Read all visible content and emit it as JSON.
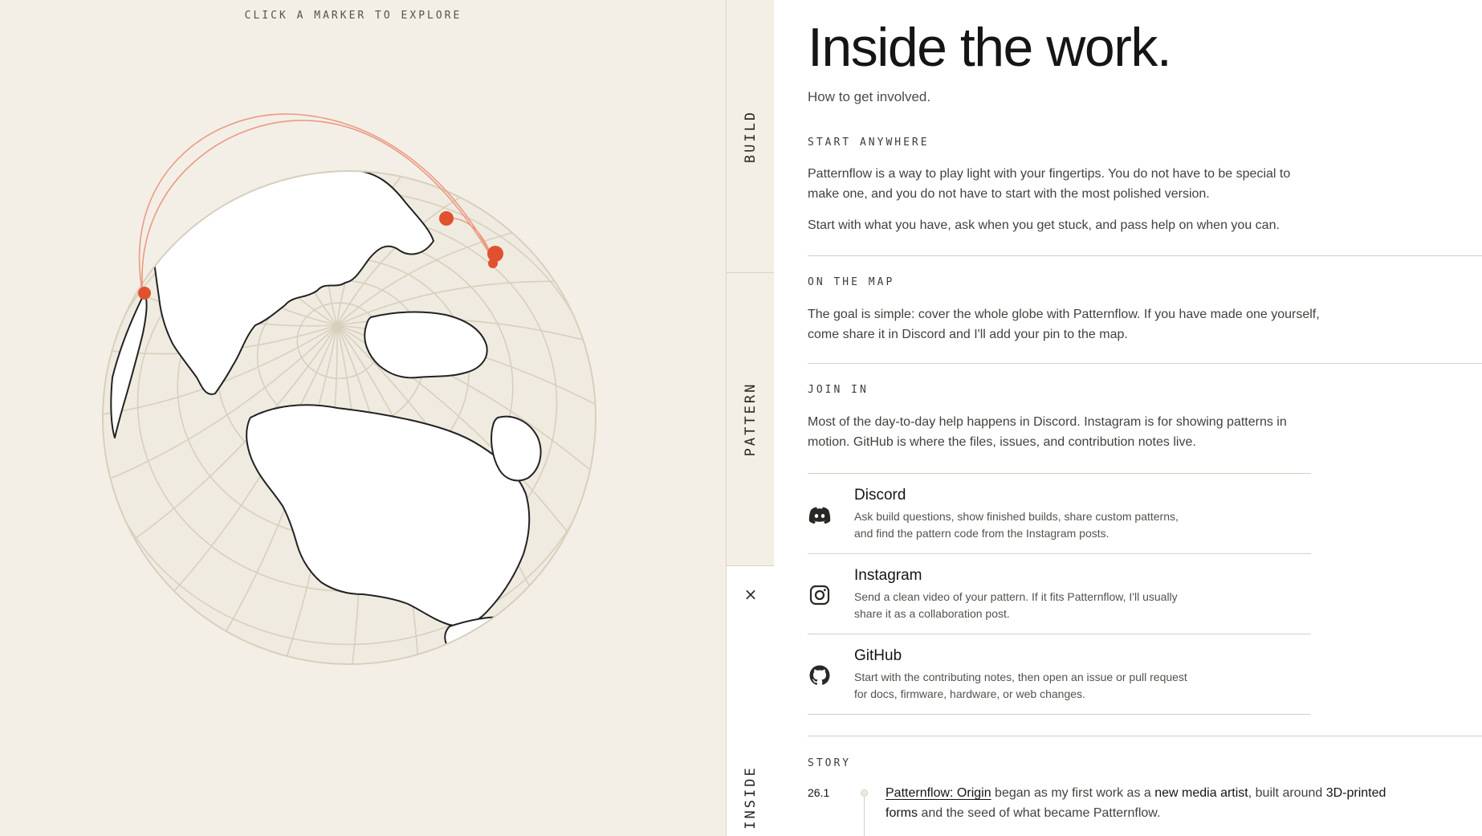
{
  "globe": {
    "hint": "CLICK A MARKER TO EXPLORE",
    "marker_color": "#e0522f",
    "arc_color": "#eb9a82"
  },
  "tabs": [
    {
      "label": "BUILD"
    },
    {
      "label": "PATTERN"
    },
    {
      "label": "INSIDE"
    }
  ],
  "close_symbol": "×",
  "content": {
    "title": "Inside the work.",
    "subtitle": "How to get involved.",
    "sections": [
      {
        "label": "START ANYWHERE",
        "paragraphs": [
          "Patternflow is a way to play light with your fingertips. You do not have to be special to make one, and you do not have to start with the most polished version.",
          "Start with what you have, ask when you get stuck, and pass help on when you can."
        ]
      },
      {
        "label": "ON THE MAP",
        "paragraphs": [
          "The goal is simple: cover the whole globe with Patternflow. If you have made one yourself, come share it in Discord and I'll add your pin to the map."
        ]
      },
      {
        "label": "JOIN IN",
        "paragraphs": [
          "Most of the day-to-day help happens in Discord. Instagram is for showing patterns in motion. GitHub is where the files, issues, and contribution notes live."
        ]
      }
    ],
    "socials": [
      {
        "name": "Discord",
        "icon": "discord-icon",
        "desc": "Ask build questions, show finished builds, share custom patterns, and find the pattern code from the Instagram posts."
      },
      {
        "name": "Instagram",
        "icon": "instagram-icon",
        "desc": "Send a clean video of your pattern. If it fits Patternflow, I'll usually share it as a collaboration post."
      },
      {
        "name": "GitHub",
        "icon": "github-icon",
        "desc": "Start with the contributing notes, then open an issue or pull request for docs, firmware, hardware, or web changes."
      }
    ],
    "story": {
      "label": "STORY",
      "entries": [
        {
          "year": "26.1",
          "link": "Patternflow: Origin",
          "t1": " began as my first work as a ",
          "b1": "new media artist",
          "t2": ", built around ",
          "b2": "3D-printed forms",
          "t3": " and the seed of what became Patternflow."
        }
      ]
    }
  }
}
